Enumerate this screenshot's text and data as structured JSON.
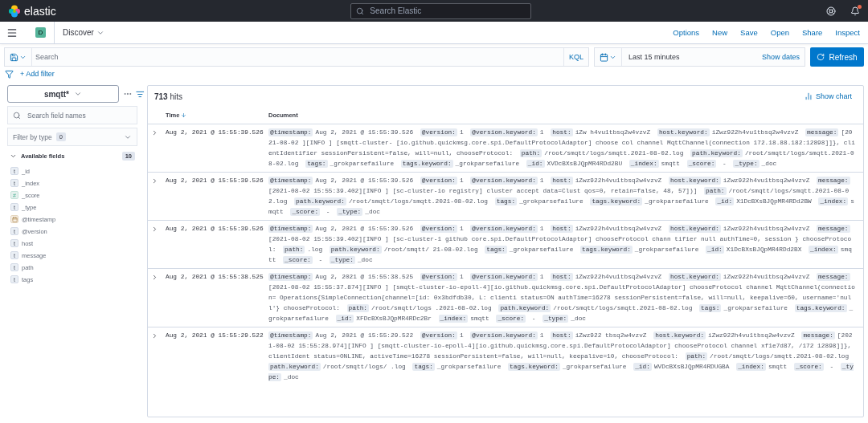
{
  "header": {
    "logo": "elastic",
    "search": {
      "placeholder": "Search Elastic"
    },
    "has_notification": true
  },
  "app_bar": {
    "badge": "D",
    "title": "Discover",
    "links": [
      "Options",
      "New",
      "Save",
      "Open",
      "Share",
      "Inspect"
    ]
  },
  "query_bar": {
    "placeholder": "Search",
    "language": "KQL",
    "date_range": "Last 15 minutes",
    "show_dates": "Show dates",
    "refresh": "Refresh"
  },
  "filter_bar": {
    "add_filter": "+ Add filter"
  },
  "sidebar": {
    "index_pattern": "smqtt*",
    "field_search": {
      "placeholder": "Search field names"
    },
    "filter_by_type": {
      "label": "Filter by type",
      "count": "0"
    },
    "available_fields": {
      "label": "Available fields",
      "count": "10",
      "expanded": true,
      "fields": [
        {
          "name": "_id",
          "kind": "string",
          "token": "t"
        },
        {
          "name": "_index",
          "kind": "string",
          "token": "t"
        },
        {
          "name": "_score",
          "kind": "number",
          "token": "#"
        },
        {
          "name": "_type",
          "kind": "string",
          "token": "t"
        },
        {
          "name": "@timestamp",
          "kind": "date"
        },
        {
          "name": "@version",
          "kind": "string",
          "token": "t"
        },
        {
          "name": "host",
          "kind": "string",
          "token": "t"
        },
        {
          "name": "message",
          "kind": "string",
          "token": "t"
        },
        {
          "name": "path",
          "kind": "string",
          "token": "t"
        },
        {
          "name": "tags",
          "kind": "string",
          "token": "t"
        }
      ]
    }
  },
  "results": {
    "hits_count": "713",
    "hits_label": "hits",
    "show_chart": "Show chart",
    "columns": [
      {
        "label": "Time",
        "sorted": true
      },
      {
        "label": "Document",
        "sorted": false
      }
    ],
    "rows": [
      {
        "time": "Aug 2, 2021 @ 15:55:39.526",
        "expanded": false,
        "document": [
          {
            "key": "@timestamp:",
            "value": "Aug 2, 2021 @ 15:55:39.526"
          },
          {
            "key": "@version:",
            "value": "1"
          },
          {
            "key": "@version.keyword:",
            "value": "1"
          },
          {
            "key": "host:",
            "value": "iZw  h4vu1tbsq2w4vzvZ"
          },
          {
            "key": "host.keyword:",
            "value": "iZwz922h4vu1tbsq2w4vzvZ"
          },
          {
            "key": "message:",
            "value": "[2021-08-02  ][INFO ] [smqtt-cluster-  [io.github.quickmsg.core.spi.DefaultProtocolAdaptor] choose  col channel MqttChannel(connection  172.18.88.182:12898]]}, clientIdentifier  sessionPersistent=false, will=null, chooseProtocol:"
          },
          {
            "key": "path:",
            "value": "/root/smqtt/logs/smqtt.2021-08-02.log"
          },
          {
            "key": "path.keyword:",
            "value": "/root/smqtt/logs/smqtt.2021-08-02.log"
          },
          {
            "key": "tags:",
            "value": "_grokparsefailure"
          },
          {
            "key": "tags.keyword:",
            "value": "_grokparsefailure"
          },
          {
            "key": "_id:",
            "value": "XVDcBXsBJQpMR4RDd2BU"
          },
          {
            "key": "_index:",
            "value": "smqtt"
          },
          {
            "key": "_score:",
            "value": " - "
          },
          {
            "key": "_type:",
            "value": "_doc"
          }
        ]
      },
      {
        "time": "Aug 2, 2021 @ 15:55:39.526",
        "expanded": false,
        "document": [
          {
            "key": "@timestamp:",
            "value": "Aug 2, 2021 @ 15:55:39.526"
          },
          {
            "key": "@version:",
            "value": "1"
          },
          {
            "key": "@version.keyword:",
            "value": "1"
          },
          {
            "key": "host:",
            "value": "iZwz922h4vu1tbsq2w4vzvZ"
          },
          {
            "key": "host.keyword:",
            "value": "iZwz922h4vu1tbsq2w4vzvZ"
          },
          {
            "key": "message:",
            "value": "[2021-08-02 15:55:39.402][INFO ] [sc-cluster-io  registry] cluster accept  data=Clust  qos=0, retain=false,  48,  57])]"
          },
          {
            "key": "path:",
            "value": "/root/smqtt/logs/smqtt.2021-08-02.log"
          },
          {
            "key": "path.keyword:",
            "value": "/root/smqtt/logs/smqtt.2021-08-02.log"
          },
          {
            "key": "tags:",
            "value": "_grokparsefailure"
          },
          {
            "key": "tags.keyword:",
            "value": "_grokparsefailure"
          },
          {
            "key": "_id:",
            "value": "X1DcBXsBJQpMR4RDd2BW"
          },
          {
            "key": "_index:",
            "value": "smqtt"
          },
          {
            "key": "_score:",
            "value": " - "
          },
          {
            "key": "_type:",
            "value": "_doc"
          }
        ]
      },
      {
        "time": "Aug 2, 2021 @ 15:55:39.526",
        "expanded": false,
        "document": [
          {
            "key": "@timestamp:",
            "value": "Aug 2, 2021 @ 15:55:39.526"
          },
          {
            "key": "@version:",
            "value": "1"
          },
          {
            "key": "@version.keyword:",
            "value": "1"
          },
          {
            "key": "host:",
            "value": "iZwz922h4vu1tbsq2w4vzvZ"
          },
          {
            "key": "host.keyword:",
            "value": "iZwz922h4vu1tbsq2w4vzvZ"
          },
          {
            "key": "message:",
            "value": "[2021-08-02 15:55:39.402][INFO ] [sc-cluster-1  github  core.spi.DefaultProtocolAdaptor] chooseProtocol chann  tifier  null authTime=0, session  } chooseProtocol:"
          },
          {
            "key": "path:",
            "value": ".log"
          },
          {
            "key": "path.keyword:",
            "value": "/root/smqtt/  21-08-02.log"
          },
          {
            "key": "tags:",
            "value": "_grokparsefailure"
          },
          {
            "key": "tags.keyword:",
            "value": "_grokparsefailure"
          },
          {
            "key": "_id:",
            "value": "X1DcBXsBJQpMR4RDd2BX"
          },
          {
            "key": "_index:",
            "value": "smqtt"
          },
          {
            "key": "_score:",
            "value": " - "
          },
          {
            "key": "_type:",
            "value": "_doc"
          }
        ]
      },
      {
        "time": "Aug 2, 2021 @ 15:55:38.525",
        "expanded": false,
        "document": [
          {
            "key": "@timestamp:",
            "value": "Aug 2, 2021 @ 15:55:38.525"
          },
          {
            "key": "@version:",
            "value": "1"
          },
          {
            "key": "@version.keyword:",
            "value": "1"
          },
          {
            "key": "host:",
            "value": "iZwz922h4vu1tbsq2w4vzvZ"
          },
          {
            "key": "host.keyword:",
            "value": "iZwz922h4vu1tbsq2w4vzvZ"
          },
          {
            "key": "message:",
            "value": "[2021-08-02 15:55:37.874][INFO ] [smqtt-cluster-io-epoll-4][io.github.quickmsg.core.spi.DefaultProtocolAdaptor] chooseProtocol channel MqttChannel(connection=  Operations{SimpleConnection{channel=[id: 0x3bdfdb30, L:  clienti  status=ON authTime=16278  sessionPersistent=false, will=null, keepalive=60, username='null'} chooseProtocol:"
          },
          {
            "key": "path:",
            "value": "/root/smqtt/logs  .2021-08-02.log"
          },
          {
            "key": "path.keyword:",
            "value": "/root/smqtt/logs/smqtt.2021-08-02.log"
          },
          {
            "key": "tags:",
            "value": "_grokparsefailure"
          },
          {
            "key": "tags.keyword:",
            "value": "_grokparsefailure"
          },
          {
            "key": "_id:",
            "value": "XFDcBXsBJQpMR4RDc2Br"
          },
          {
            "key": "_index:",
            "value": "smqtt"
          },
          {
            "key": "_score:",
            "value": " - "
          },
          {
            "key": "_type:",
            "value": "_doc"
          }
        ]
      },
      {
        "time": "Aug 2, 2021 @ 15:55:29.522",
        "expanded": false,
        "document": [
          {
            "key": "@timestamp:",
            "value": "Aug 2, 2021 @ 15:55:29.522"
          },
          {
            "key": "@version:",
            "value": "1"
          },
          {
            "key": "@version.keyword:",
            "value": "1"
          },
          {
            "key": "host:",
            "value": "iZwz922  tbsq2w4vzvZ"
          },
          {
            "key": "host.keyword:",
            "value": "iZwz922h4vu1tbsq2w4vzvZ"
          },
          {
            "key": "message:",
            "value": "[2021-08-02 15:55:28.974][INFO ] [smqtt-cluster-io-epoll-4][io.github.quickmsg.core.spi.DefaultProtocolAdaptor] chooseProtocol channel  xf1e7d87, /172  12898]]}, clientIdent  status=ONLINE, activeTime=16278  sessionPersistent=false, will=null, keepalive=10,  chooseProtocol:"
          },
          {
            "key": "path:",
            "value": "/root/smqtt/logs/smqtt.2021-08-02.log"
          },
          {
            "key": "path.keyword:",
            "value": "/root/smqtt/logs/  .log"
          },
          {
            "key": "tags:",
            "value": "_grokparsefailure"
          },
          {
            "key": "tags.keyword:",
            "value": "_grokparsefailure"
          },
          {
            "key": "_id:",
            "value": "WVDcBXsBJQpMR4RDUGBA"
          },
          {
            "key": "_index:",
            "value": "smqtt"
          },
          {
            "key": "_score:",
            "value": " - "
          },
          {
            "key": "_type:",
            "value": "_doc"
          }
        ]
      }
    ]
  }
}
